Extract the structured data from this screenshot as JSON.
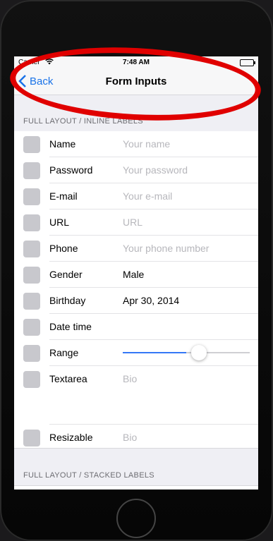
{
  "status": {
    "carrier": "Carrier",
    "time": "7:48 AM"
  },
  "nav": {
    "back_label": "Back",
    "title": "Form Inputs"
  },
  "sections": {
    "inline_header": "FULL LAYOUT / INLINE LABELS",
    "stacked_header": "FULL LAYOUT / STACKED LABELS"
  },
  "rows": [
    {
      "label": "Name",
      "placeholder": "Your name"
    },
    {
      "label": "Password",
      "placeholder": "Your password"
    },
    {
      "label": "E-mail",
      "placeholder": "Your e-mail"
    },
    {
      "label": "URL",
      "placeholder": "URL"
    },
    {
      "label": "Phone",
      "placeholder": "Your phone number"
    },
    {
      "label": "Gender",
      "value": "Male"
    },
    {
      "label": "Birthday",
      "value": "Apr 30, 2014"
    },
    {
      "label": "Date time"
    },
    {
      "label": "Range",
      "slider_fraction": 0.5
    },
    {
      "label": "Textarea",
      "placeholder": "Bio"
    },
    {
      "label": "Resizable",
      "placeholder": "Bio"
    }
  ],
  "colors": {
    "accent": "#3478F6",
    "annotation": "#E00000"
  }
}
